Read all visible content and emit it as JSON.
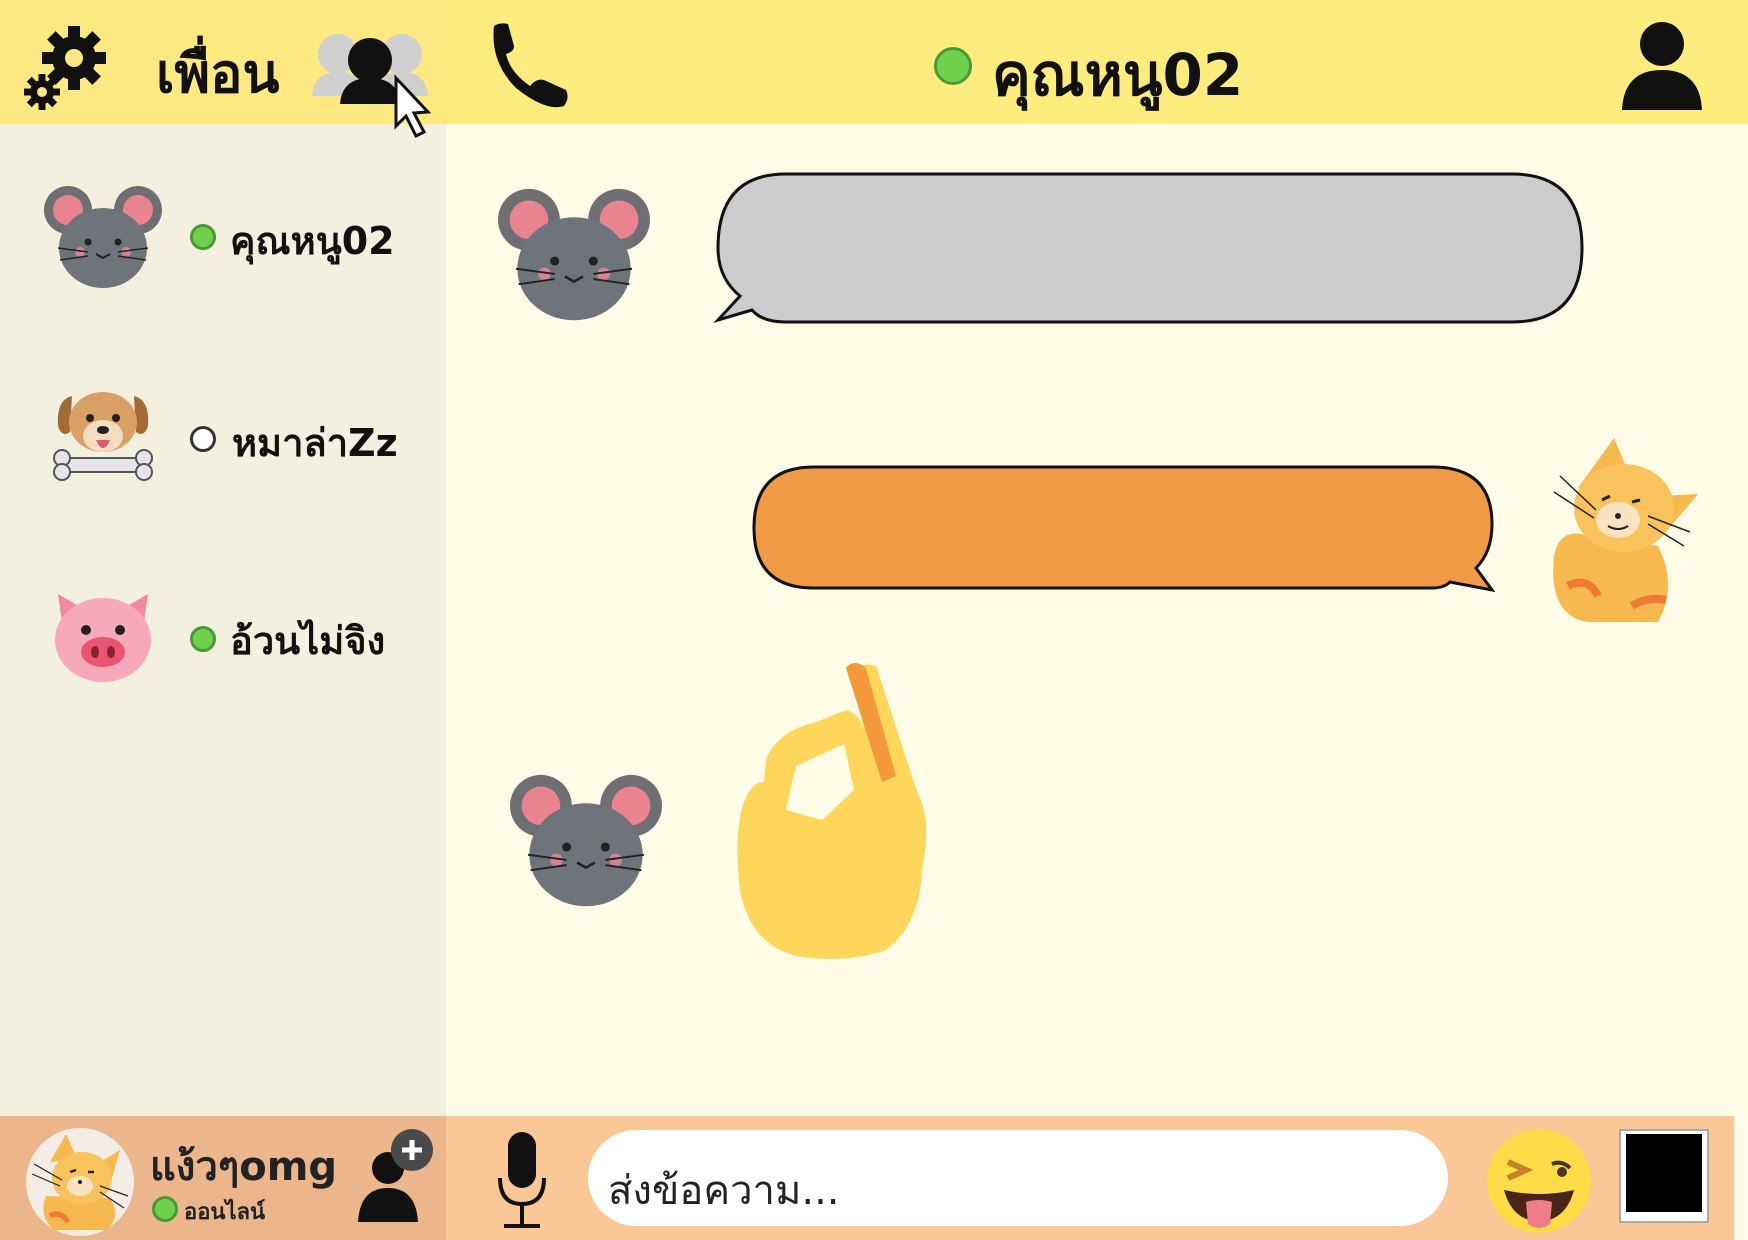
{
  "header": {
    "friends_title": "เพื่อน",
    "chat_title": "คุณหนู02",
    "chat_status": "online"
  },
  "friends": [
    {
      "name": "คุณหนู02",
      "avatar": "mouse-avatar",
      "status": "online"
    },
    {
      "name": "หมาล่าZz",
      "avatar": "dog-avatar",
      "status": "offline"
    },
    {
      "name": "อ้วนไม่จิง",
      "avatar": "pig-avatar",
      "status": "online"
    }
  ],
  "messages": [
    {
      "from": "คุณหนู02",
      "type": "text-bubble",
      "color": "#cccccc"
    },
    {
      "from": "me",
      "type": "text-bubble",
      "color": "#ef9a45"
    },
    {
      "from": "คุณหนู02",
      "type": "sticker",
      "sticker": "ok-hand"
    }
  ],
  "me": {
    "name": "แง้วๆomg",
    "status_text": "ออนไลน์"
  },
  "composer": {
    "placeholder": "ส่งข้อความ..."
  },
  "colors": {
    "header_yellow": "#feec7f",
    "sidebar_bg": "#f4f0e0",
    "chat_bg": "#fefbe6",
    "footer_left": "#ebb68c",
    "footer_right": "#fac797",
    "online_green": "#6fd04d",
    "incoming_bubble": "#cccccc",
    "outgoing_bubble": "#ef9a45"
  }
}
